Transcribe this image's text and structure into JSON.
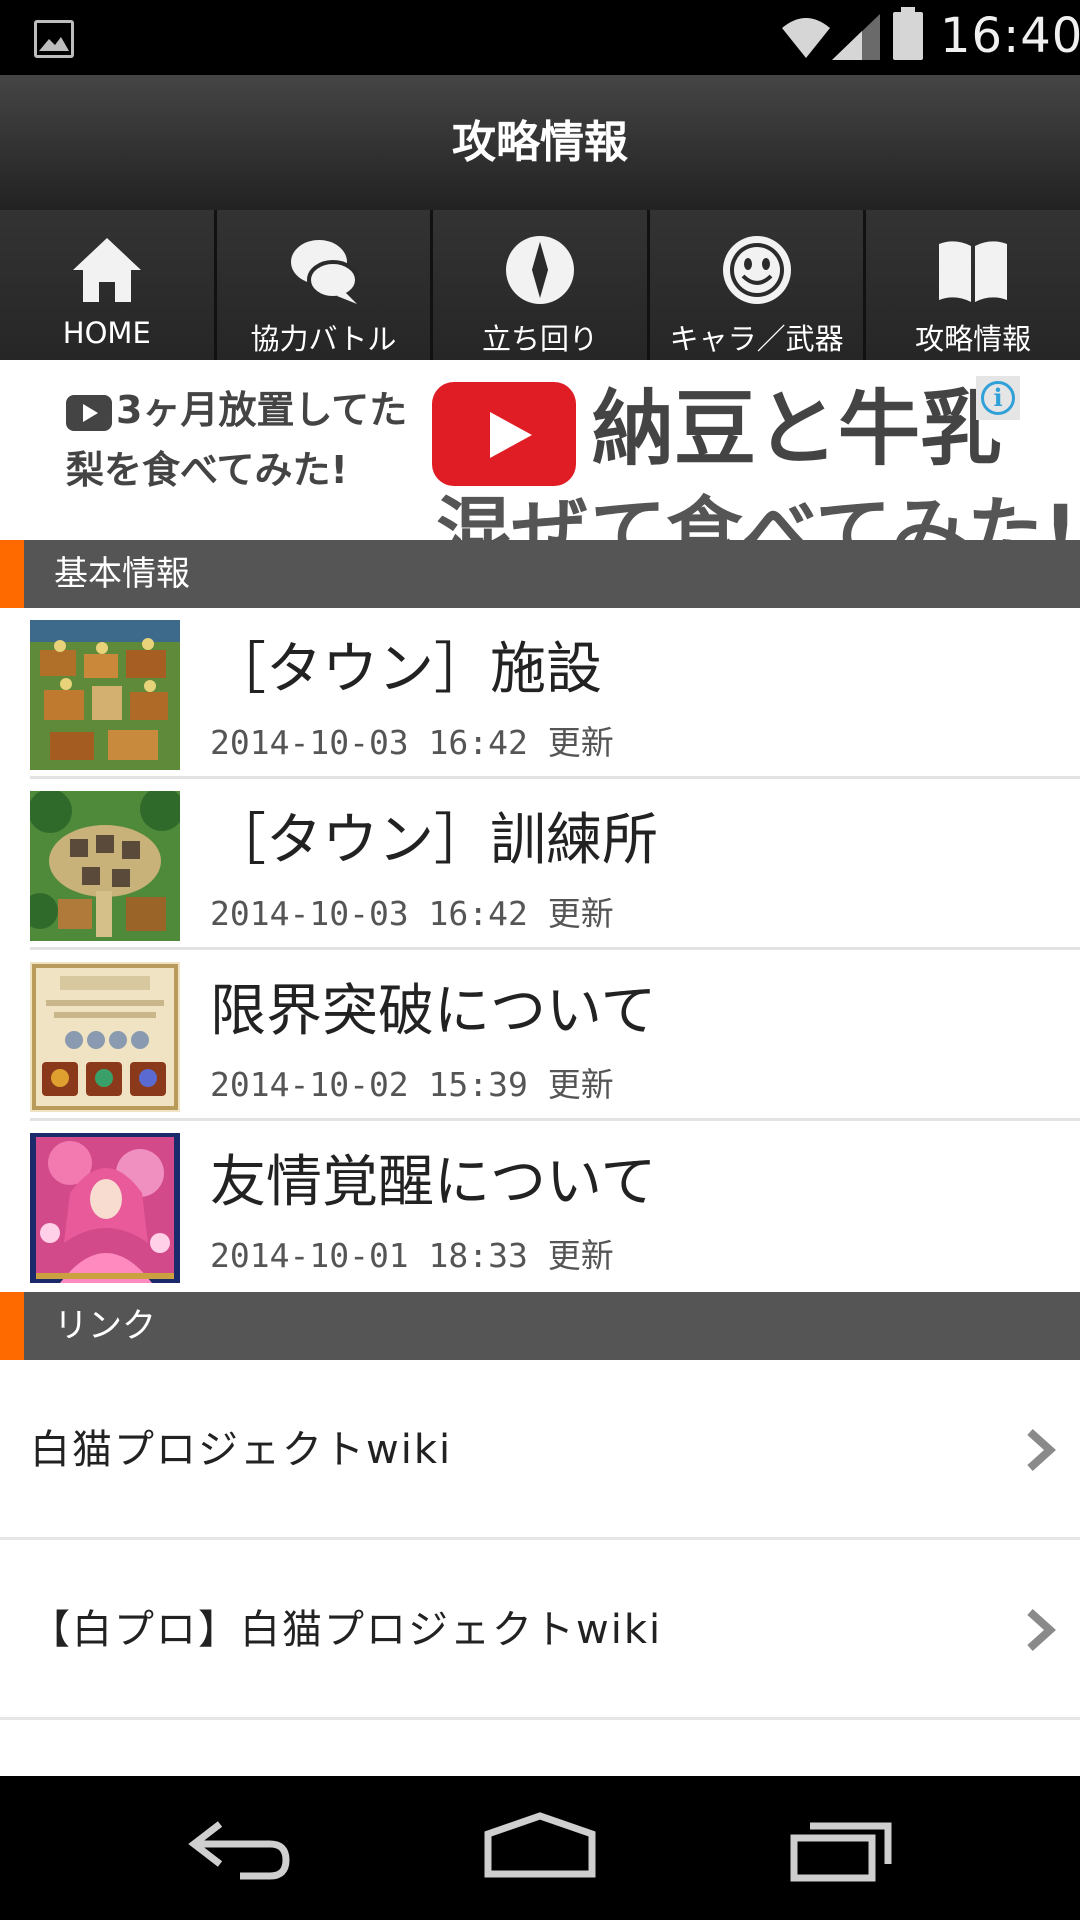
{
  "status_bar": {
    "time": "16:40"
  },
  "header": {
    "title": "攻略情報"
  },
  "nav": [
    {
      "label": "HOME",
      "icon": "home-icon"
    },
    {
      "label": "協力バトル",
      "icon": "chat-bubbles-icon"
    },
    {
      "label": "立ち回り",
      "icon": "compass-icon"
    },
    {
      "label": "キャラ／武器",
      "icon": "smiley-icon"
    },
    {
      "label": "攻略情報",
      "icon": "book-icon"
    }
  ],
  "ad": {
    "left_line1": "3ヶ月放置してた",
    "left_line2": "梨を食べてみた!",
    "right_line1": "納豆と牛乳",
    "right_line2": "混ぜて食べてみた!",
    "info": "i",
    "colors": {
      "youtube_red": "#e01c24",
      "info_blue": "#2fa0d8"
    }
  },
  "sections": {
    "basic": {
      "label": "基本情報"
    },
    "links": {
      "label": "リンク"
    }
  },
  "articles": [
    {
      "title": "［タウン］施設",
      "date": "2014-10-03 16:42 更新",
      "thumb": "town-facility-thumbnail"
    },
    {
      "title": "［タウン］訓練所",
      "date": "2014-10-03 16:42 更新",
      "thumb": "town-training-thumbnail"
    },
    {
      "title": "限界突破について",
      "date": "2014-10-02 15:39 更新",
      "thumb": "limit-break-thumbnail"
    },
    {
      "title": "友情覚醒について",
      "date": "2014-10-01 18:33 更新",
      "thumb": "friendship-awakening-thumbnail"
    }
  ],
  "links": [
    {
      "label": "白猫プロジェクトwiki"
    },
    {
      "label": "【白プロ】白猫プロジェクトwiki"
    }
  ],
  "colors": {
    "accent": "#ff6a00",
    "section_bg": "#555555",
    "header_dark": "#222222"
  }
}
